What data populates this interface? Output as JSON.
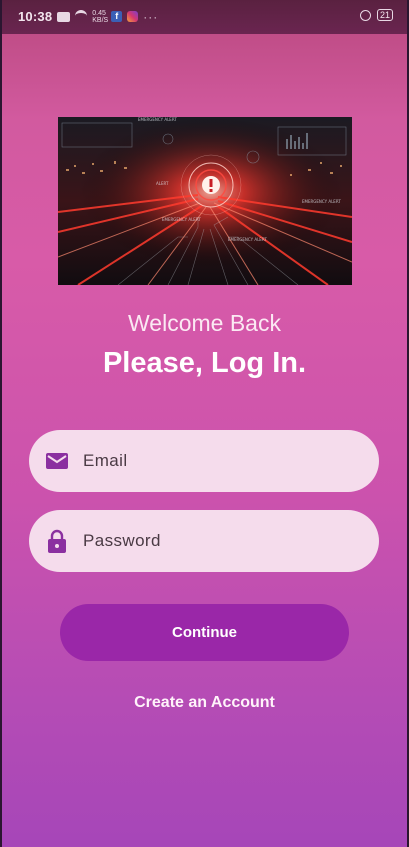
{
  "status_bar": {
    "time": "10:38",
    "network_speed": "0.45 KB/S",
    "battery": "21"
  },
  "hero_image": {
    "alt_icon": "emergency-alert-illustration",
    "embedded_text": [
      "EMERGENCY ALERT",
      "EMERGENCY ALERT",
      "EMERGENCY ALERT",
      "EMERGENCY ALERT",
      "ALERT"
    ]
  },
  "login": {
    "welcome": "Welcome Back",
    "title": "Please, Log In.",
    "email_placeholder": "Email",
    "password_placeholder": "Password",
    "continue_label": "Continue",
    "create_account_label": "Create an Account"
  },
  "colors": {
    "accent": "#9a27a8",
    "field_bg": "#f5dcec",
    "icon": "#8b2fa0"
  }
}
